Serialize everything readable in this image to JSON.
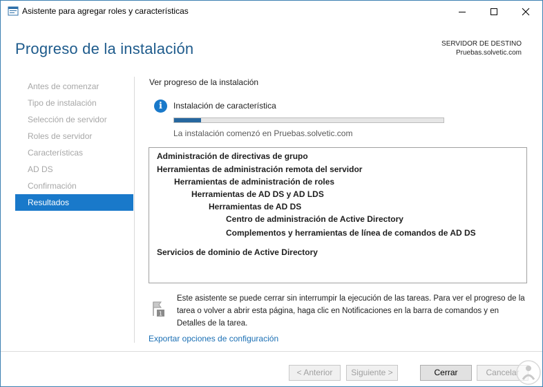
{
  "window": {
    "title": "Asistente para agregar roles y características"
  },
  "header": {
    "page_title": "Progreso de la instalación",
    "destination_label": "SERVIDOR DE DESTINO",
    "destination_server": "Pruebas.solvetic.com"
  },
  "nav": {
    "items": [
      {
        "label": "Antes de comenzar",
        "active": false
      },
      {
        "label": "Tipo de instalación",
        "active": false
      },
      {
        "label": "Selección de servidor",
        "active": false
      },
      {
        "label": "Roles de servidor",
        "active": false
      },
      {
        "label": "Características",
        "active": false
      },
      {
        "label": "AD DS",
        "active": false
      },
      {
        "label": "Confirmación",
        "active": false
      },
      {
        "label": "Resultados",
        "active": true
      }
    ]
  },
  "main": {
    "section_label": "Ver progreso de la instalación",
    "status_text": "Instalación de característica",
    "progress_fraction": 0.1,
    "started_text": "La instalación comenzó en Pruebas.solvetic.com",
    "results": [
      {
        "text": "Administración de directivas de grupo",
        "level": 0
      },
      {
        "text": "Herramientas de administración remota del servidor",
        "level": 0
      },
      {
        "text": "Herramientas de administración de roles",
        "level": 1
      },
      {
        "text": "Herramientas de AD DS y AD LDS",
        "level": 2
      },
      {
        "text": "Herramientas de AD DS",
        "level": 3
      },
      {
        "text": "Centro de administración de Active Directory",
        "level": 4
      },
      {
        "text": "Complementos y herramientas de línea de comandos de AD DS",
        "level": 4
      },
      {
        "text": "Servicios de dominio de Active Directory",
        "level": 0
      }
    ],
    "note_text": "Este asistente se puede cerrar sin interrumpir la ejecución de las tareas. Para ver el progreso de la tarea o volver a abrir esta página, haga clic en Notificaciones en la barra de comandos y en Detalles de la tarea.",
    "note_badge": "1",
    "export_link": "Exportar opciones de configuración"
  },
  "buttons": {
    "previous": "< Anterior",
    "next": "Siguiente >",
    "close": "Cerrar",
    "cancel": "Cancelar"
  },
  "colors": {
    "accent": "#1979ca",
    "title": "#1e5b8c",
    "progress": "#26679f",
    "link": "#1a6fb4"
  }
}
